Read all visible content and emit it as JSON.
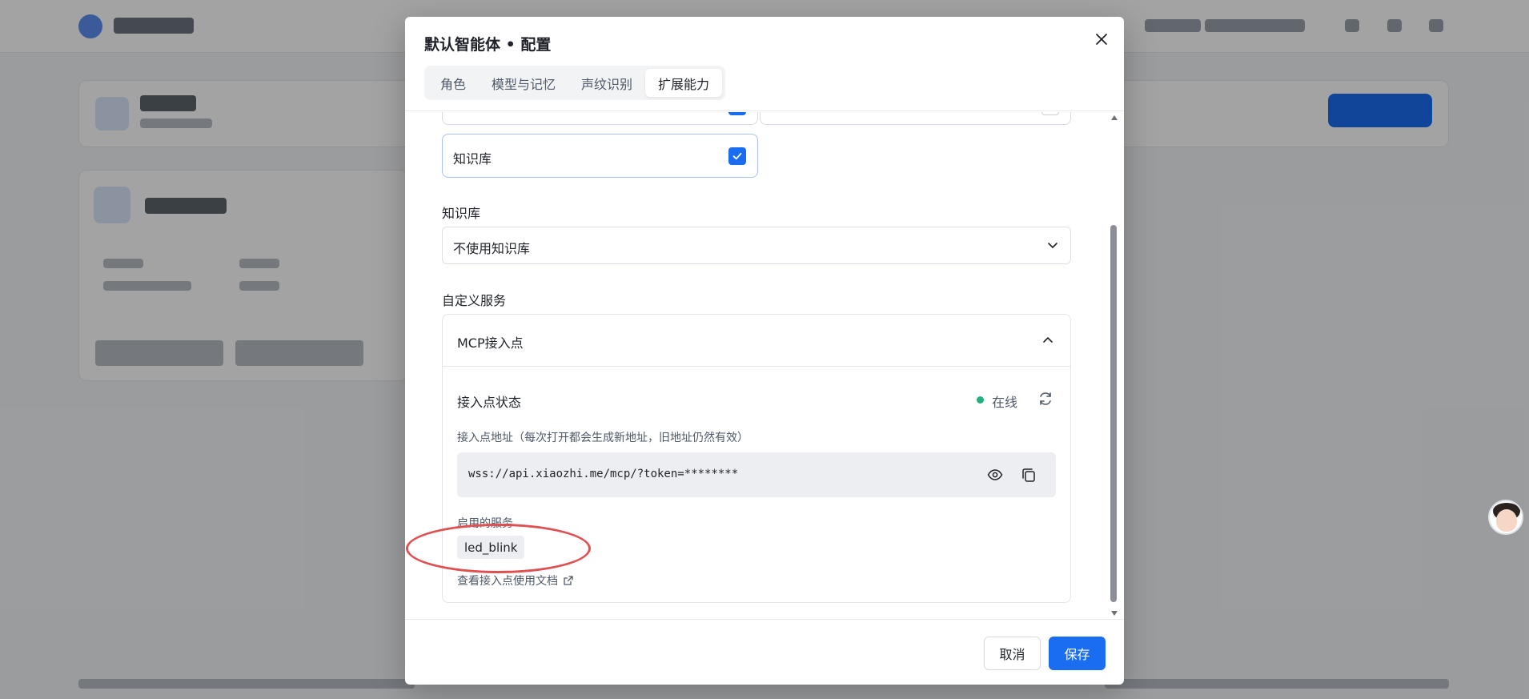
{
  "modal": {
    "title": "默认智能体 • 配置",
    "tabs": [
      {
        "label": "角色",
        "active": false
      },
      {
        "label": "模型与记忆",
        "active": false
      },
      {
        "label": "声纹识别",
        "active": false
      },
      {
        "label": "扩展能力",
        "active": true
      }
    ],
    "capability": {
      "label": "知识库",
      "checked": true
    },
    "knowledge_base": {
      "label": "知识库",
      "selected": "不使用知识库"
    },
    "custom_service": {
      "label": "自定义服务",
      "accordion_title": "MCP接入点",
      "status_label": "接入点状态",
      "status_value": "在线",
      "status_color": "#22b07d",
      "address_label": "接入点地址（每次打开都会生成新地址，旧地址仍然有效）",
      "address_value": "wss://api.xiaozhi.me/mcp/?token=********",
      "enabled_services_label": "启用的服务",
      "enabled_services": [
        "led_blink"
      ],
      "doc_link": "查看接入点使用文档"
    },
    "footer": {
      "cancel_label": "取消",
      "save_label": "保存"
    }
  },
  "colors": {
    "primary": "#1a6cf0",
    "annotation": "#e05050",
    "online": "#22b07d"
  }
}
